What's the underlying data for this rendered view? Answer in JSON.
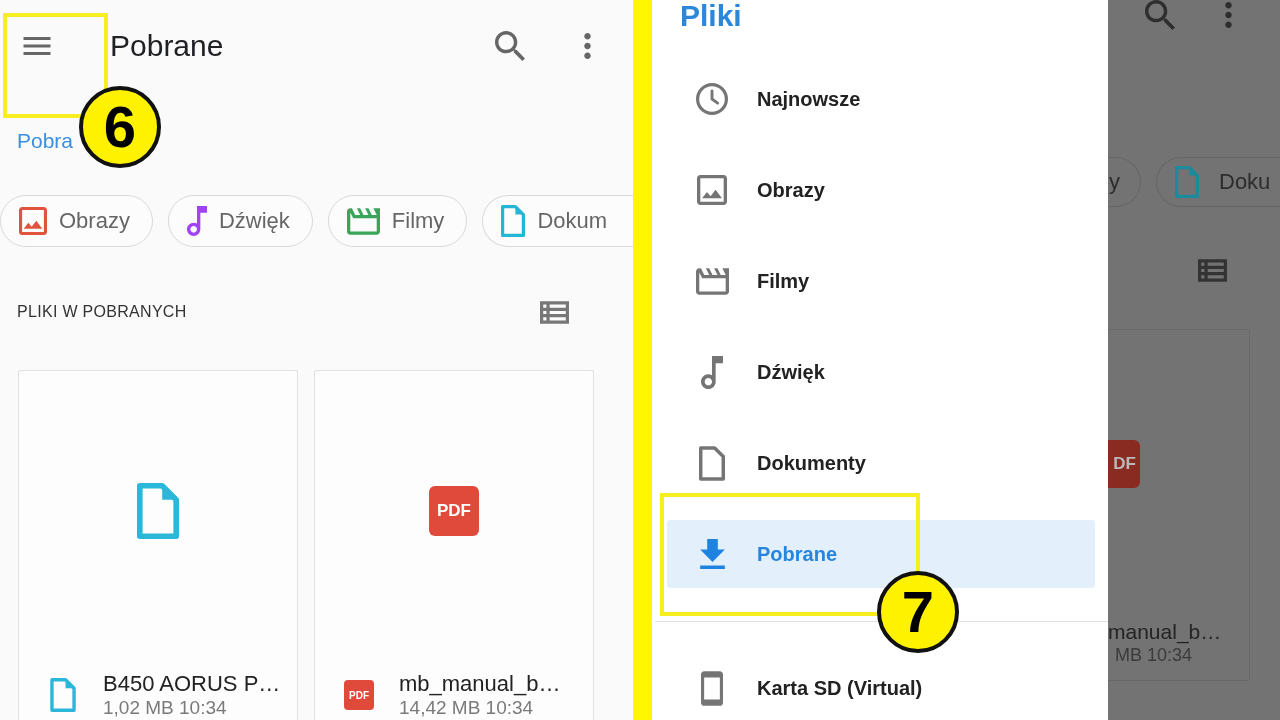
{
  "app_bar": {
    "title": "Pobrane"
  },
  "breadcrumb": "Pobra",
  "chips": [
    {
      "kind": "images",
      "label": "Obrazy",
      "color": "#e0533d"
    },
    {
      "kind": "audio",
      "label": "Dźwięk",
      "color": "#a142f4"
    },
    {
      "kind": "video",
      "label": "Filmy",
      "color": "#3aa55a"
    },
    {
      "kind": "documents",
      "label": "Dokum",
      "color": "#24b6d4"
    }
  ],
  "section": {
    "title": "PLIKI W POBRANYCH"
  },
  "files": [
    {
      "kind": "generic",
      "name": "B450 AORUS P…",
      "meta": "1,02 MB 10:34"
    },
    {
      "kind": "pdf",
      "preview_badge": "PDF",
      "icon_badge": "PDF",
      "name": "mb_manual_b…",
      "meta": "14,42 MB 10:34"
    }
  ],
  "drawer": {
    "title": "Pliki",
    "items": [
      {
        "kind": "recent",
        "label": "Najnowsze",
        "selected": false
      },
      {
        "kind": "images",
        "label": "Obrazy",
        "selected": false
      },
      {
        "kind": "video",
        "label": "Filmy",
        "selected": false
      },
      {
        "kind": "audio",
        "label": "Dźwięk",
        "selected": false
      },
      {
        "kind": "documents",
        "label": "Dokumenty",
        "selected": false
      },
      {
        "kind": "downloads",
        "label": "Pobrane",
        "selected": true
      }
    ],
    "storage": [
      {
        "kind": "sd_card",
        "label": "Karta SD (Virtual)",
        "selected": false
      }
    ]
  },
  "dimmed_app": {
    "chips": [
      {
        "label": "y"
      },
      {
        "kind": "documents",
        "label": "Doku"
      }
    ],
    "file": {
      "kind": "pdf",
      "badge": "DF",
      "name": "manual_b…",
      "meta": "MB 10:34"
    }
  },
  "annotations": [
    {
      "kind": "menu",
      "number": "6"
    },
    {
      "kind": "drawer_selected",
      "number": "7"
    }
  ]
}
